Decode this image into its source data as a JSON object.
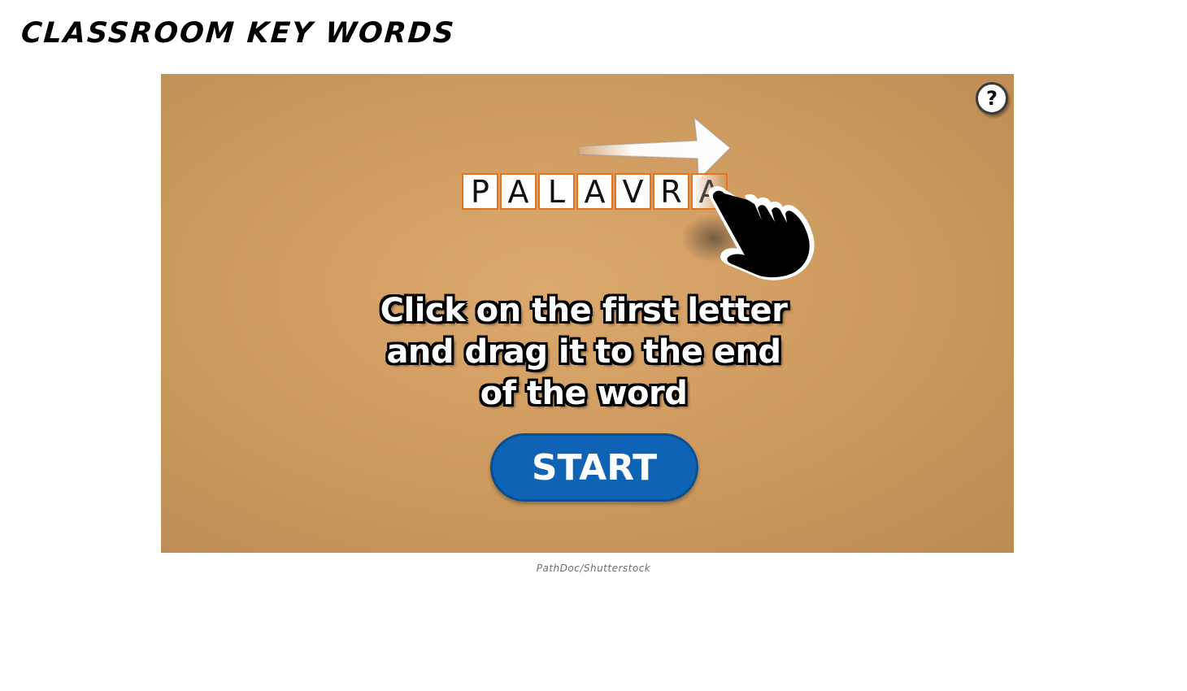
{
  "page": {
    "title": "CLASSROOM KEY WORDS",
    "credit": "PathDoc/Shutterstock"
  },
  "game": {
    "help_label": "?",
    "word_tiles": [
      "P",
      "A",
      "L",
      "A",
      "V",
      "R",
      "A"
    ],
    "instruction_lines": [
      "Click on the first letter",
      "and drag it to the end",
      "of the word"
    ],
    "start_label": "START"
  },
  "colors": {
    "board": "#d29e64",
    "tile_border": "#e2751f",
    "start_button": "#0e63b4"
  },
  "icons": {
    "help": "question-mark-icon",
    "arrow": "right-arrow-icon",
    "hand": "pointing-hand-icon"
  }
}
